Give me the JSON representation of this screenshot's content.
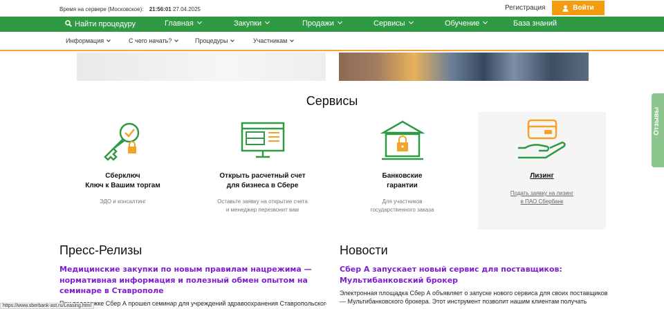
{
  "header": {
    "server_time_label": "Время на сервере (Московское):",
    "server_time": "21:56:01",
    "server_date": "27.04.2025",
    "register": "Регистрация",
    "login": "Войти"
  },
  "main_nav": [
    {
      "label": "Найти процедуру"
    },
    {
      "label": "Главная"
    },
    {
      "label": "Закупки"
    },
    {
      "label": "Продажи"
    },
    {
      "label": "Сервисы"
    },
    {
      "label": "Обучение"
    },
    {
      "label": "База знаний"
    }
  ],
  "sub_nav": [
    {
      "label": "Информация"
    },
    {
      "label": "С чего начать?"
    },
    {
      "label": "Процедуры"
    },
    {
      "label": "Участникам"
    }
  ],
  "services_title": "Сервисы",
  "services": [
    {
      "name_line1": "Сберключ",
      "name_line2": "Ключ к Вашим торгам",
      "desc_line1": "ЭДО и консалтинг",
      "desc_line2": ""
    },
    {
      "name_line1": "Открыть расчетный счет",
      "name_line2": "для бизнеса в Сбере",
      "desc_line1": "Оставьте заявку на открытие счета",
      "desc_line2": "и менеджер перезвонит вам"
    },
    {
      "name_line1": "Банковские",
      "name_line2": "гарантии",
      "desc_line1": "Для участников",
      "desc_line2": "государственного заказа"
    },
    {
      "name_line1": "Лизинг",
      "name_line2": "",
      "desc_line1": "Подать заявку на лизинг",
      "desc_line2": "в ПАО Сбербанк"
    }
  ],
  "feedback": "Отзывы",
  "press": {
    "title": "Пресс-Релизы",
    "headline_1": "Медицинские закупки по новым правилам нацрежима —",
    "headline_2": "нормативная информация и полезный обмен опытом на",
    "headline_3": "семинаре в Ставрополе",
    "text": "При поддержке Сбер А прошел семинар для учреждений здравоохранения Ставропольского"
  },
  "news": {
    "title": "Новости",
    "headline_1": "Сбер А запускает новый сервис для поставщиков:",
    "headline_2": "Мультибанковский брокер",
    "text_1": "Электронная площадка Сбер А объявляет о запуске нового сервиса для своих поставщиков",
    "text_2": "— Мультибанковского брокера. Этот инструмент позволит нашим клиентам получать"
  },
  "status_url": "https://www.sberbank-ast.ru/Leasing.html",
  "colors": {
    "green": "#2f9a43",
    "orange": "#f39c12",
    "link_purple": "#7b1fd1"
  }
}
